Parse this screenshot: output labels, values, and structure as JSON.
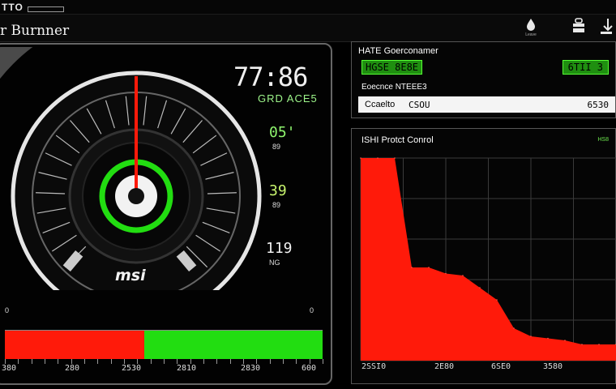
{
  "titlebar": {
    "app_name": "TTO",
    "subtitle": ""
  },
  "header": {
    "title": "r Burnner",
    "buttons": [
      {
        "name": "profile",
        "label": "Leave"
      },
      {
        "name": "lock",
        "label": ""
      },
      {
        "name": "download",
        "label": ""
      }
    ]
  },
  "gauge": {
    "speed": "77:86",
    "unit": "GRD ACE5",
    "brand": "msi",
    "needle_fraction": 0.5,
    "stats": [
      {
        "value": "05'",
        "label": "89",
        "color": "#8ff56e"
      },
      {
        "value": "39",
        "label": "89",
        "color": "#c8f56e"
      },
      {
        "value": "119",
        "label": "NG",
        "color": "#f0f0f0"
      }
    ]
  },
  "load_bar": {
    "red_fraction": 0.44,
    "left_marker": "0",
    "right_marker": "0",
    "labels": [
      "380",
      "280",
      "2530",
      "2810",
      "2830",
      "600"
    ]
  },
  "info": {
    "title": "HATE Goerconamer",
    "badge": "HGSE 8E8E",
    "badge_value": "6TII 3",
    "row": "Eoecnce NTEEE3",
    "white_left": "Ccaelto",
    "white_mid": "CSOU",
    "white_right": "6530"
  },
  "chart": {
    "title": "ISHI Protct Conrol",
    "tag": "HS8",
    "x_labels": [
      "2SSI0",
      "2E80",
      "6SE0",
      "3580"
    ]
  },
  "chart_data": {
    "type": "area",
    "title": "ISHI Protct Conrol",
    "x_ticks": [
      "2SSI0",
      "2E80",
      "6SE0",
      "3580"
    ],
    "values": [
      100,
      100,
      100,
      46,
      46,
      43,
      42,
      36,
      30,
      16,
      12,
      11,
      10,
      8,
      8,
      8
    ],
    "ylim": [
      0,
      100
    ],
    "grid": true,
    "color": "#ff1a0a"
  },
  "colors": {
    "red": "#ff1a0a",
    "green": "#22dd11",
    "accent_green": "#55ff33"
  }
}
